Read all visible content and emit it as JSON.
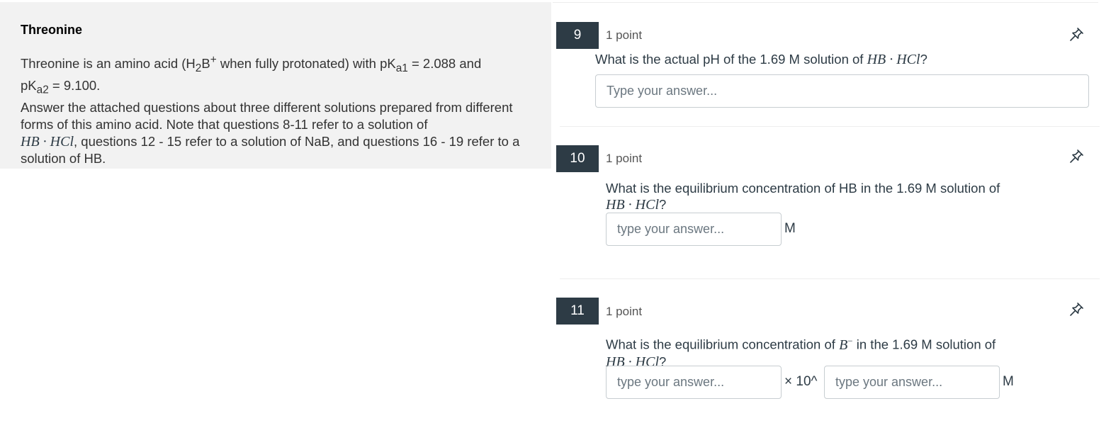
{
  "passage": {
    "title": "Threonine",
    "intro_a": "Threonine is an amino acid (H",
    "intro_sub1": "2",
    "intro_b": "B",
    "intro_sup": "+",
    "intro_c": " when fully protonated) with pK",
    "intro_sub2": "a1",
    "intro_d": " = 2.088 and",
    "line2_a": "pK",
    "line2_sub": "a2",
    "line2_b": " = 9.100.",
    "line3": "Answer the attached questions about three different solutions prepared from different forms of this amino acid. Note that questions 8-11 refer to a solution of",
    "formula": "HB · HCl",
    "line4": ", questions 12 - 15 refer to a solution of NaB, and questions 16 - 19 refer to a solution of HB."
  },
  "questions": [
    {
      "number": "9",
      "points": "1 point",
      "text_a": "What is the actual pH of the 1.69 M solution of ",
      "formula": "HB · HCl",
      "text_b": "?",
      "placeholder": "Type your answer..."
    },
    {
      "number": "10",
      "points": "1 point",
      "text_a": "What is the equilibrium concentration of HB in the 1.69 M solution of",
      "formula": "HB · HCl",
      "text_b": "?",
      "placeholder": "type your answer...",
      "unit": "M"
    },
    {
      "number": "11",
      "points": "1 point",
      "text_a": "What is the equilibrium concentration of ",
      "ion_base": "B",
      "ion_sup": "−",
      "text_c": " in the 1.69 M solution of",
      "formula": "HB · HCl",
      "text_b": "?",
      "placeholder_mantissa": "type your answer...",
      "times_ten": "× 10^",
      "placeholder_exponent": "type your answer...",
      "unit": "M"
    }
  ],
  "icons": {
    "pin": "pin-icon"
  },
  "colors": {
    "badge": "#2d3b45",
    "panel": "#f2f2f2",
    "text": "#2d3b45"
  }
}
